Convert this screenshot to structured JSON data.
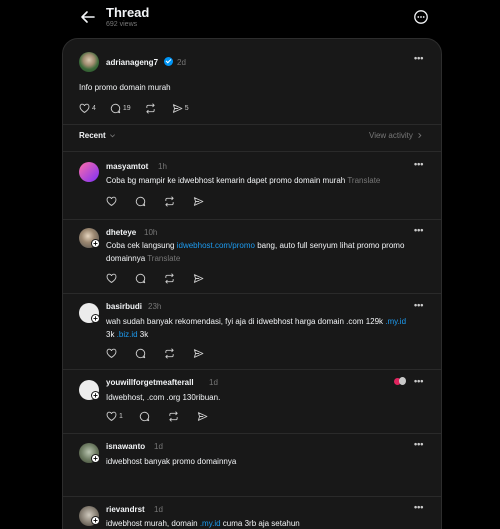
{
  "header": {
    "title": "Thread",
    "views": "692 views"
  },
  "original_post": {
    "username": "adrianageng7",
    "time": "2d",
    "text": "Info promo domain murah",
    "likes": "4",
    "comments": "19",
    "shares": "5"
  },
  "sort": {
    "label": "Recent",
    "view_activity": "View activity"
  },
  "replies": [
    {
      "username": "masyamtot",
      "time": "1h",
      "text": "Coba bg mampir ke idwebhost kemarin dapet promo domain murah",
      "translate": "Translate"
    },
    {
      "username": "dheteye",
      "time": "10h",
      "text_before": "Coba cek langsung ",
      "link": "idwebhost.com/promo",
      "text_after": " bang, auto full senyum lihat promo promo domainnya",
      "translate": "Translate"
    },
    {
      "username": "basirbudi",
      "time": "23h",
      "text_before": "wah sudah banyak rekomendasi, fyi aja di idwebhost harga domain .com 129k ",
      "link1": ".my.id",
      "text_mid": " 3k ",
      "link2": ".biz.id",
      "text_after": " 3k"
    },
    {
      "username": "youwillforgetmeafterall",
      "time": "1d",
      "text": "Idwebhost, .com .org 130ribuan.",
      "likes": "1"
    },
    {
      "username": "isnawanto",
      "time": "1d",
      "text": "idwebhost banyak promo domainnya"
    },
    {
      "username": "rievandrst",
      "time": "1d",
      "text_before": "idwebhost murah, domain ",
      "link": ".my.id",
      "text_after": " cuma 3rb aja setahun"
    }
  ],
  "icons": [
    "back-arrow-icon",
    "more-icon",
    "heart-icon",
    "comment-icon",
    "repost-icon",
    "share-icon",
    "chevron-down-icon",
    "chevron-right-icon",
    "verified-icon",
    "follow-plus-icon"
  ]
}
